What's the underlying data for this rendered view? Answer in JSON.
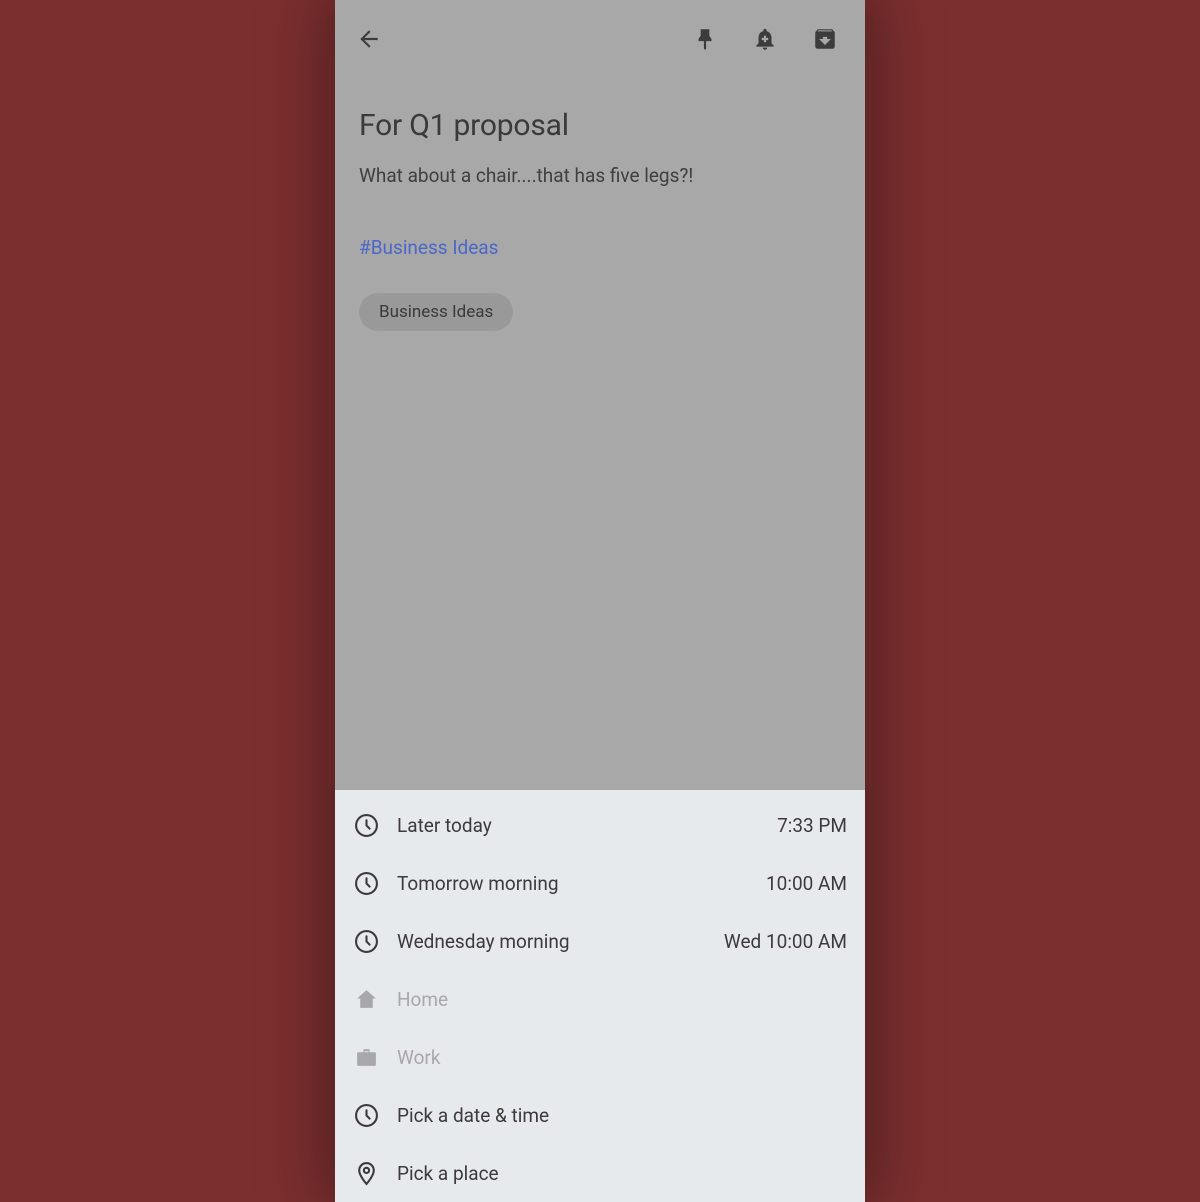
{
  "note": {
    "title": "For Q1 proposal",
    "body": "What about a chair....that has five legs?!",
    "hashtag": "#Business Ideas",
    "chip": "Business Ideas"
  },
  "sheet": {
    "rows": [
      {
        "icon": "clock",
        "label": "Later today",
        "time": "7:33 PM",
        "disabled": false
      },
      {
        "icon": "clock",
        "label": "Tomorrow morning",
        "time": "10:00 AM",
        "disabled": false
      },
      {
        "icon": "clock",
        "label": "Wednesday morning",
        "time": "Wed 10:00 AM",
        "disabled": false
      },
      {
        "icon": "home",
        "label": "Home",
        "time": "",
        "disabled": true
      },
      {
        "icon": "briefcase",
        "label": "Work",
        "time": "",
        "disabled": true
      },
      {
        "icon": "clock",
        "label": "Pick a date & time",
        "time": "",
        "disabled": false
      },
      {
        "icon": "pin",
        "label": "Pick a place",
        "time": "",
        "disabled": false
      }
    ]
  }
}
